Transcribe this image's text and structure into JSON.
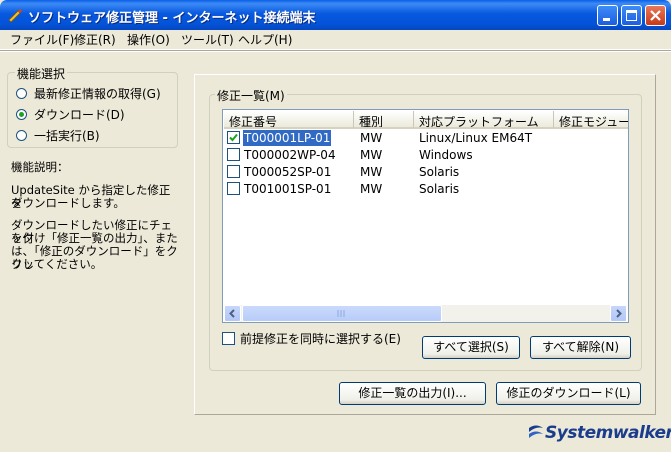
{
  "window": {
    "title": "ソフトウェア修正管理 - インターネット接続端末"
  },
  "menu": [
    "ファイル(F)",
    "修正(R)",
    "操作(O)",
    "ツール(T)",
    "ヘルプ(H)"
  ],
  "function_select": {
    "legend": "機能選択",
    "options": [
      {
        "label": "最新修正情報の取得(G)",
        "selected": false
      },
      {
        "label": "ダウンロード(D)",
        "selected": true
      },
      {
        "label": "一括実行(B)",
        "selected": false
      }
    ]
  },
  "description": {
    "heading": "機能説明：",
    "line1": "UpdateSite から指定した修正を",
    "line2": "ダウンロードします。",
    "line3": "ダウンロードしたい修正にチェック",
    "line4": "を付け「修正一覧の出力」、また",
    "line5": "は、「修正のダウンロード」をクリッ",
    "line6": "クしてください。"
  },
  "fix_list": {
    "legend": "修正一覧(M)",
    "columns": [
      "修正番号",
      "種別",
      "対応プラットフォーム",
      "修正モジュー"
    ],
    "rows": [
      {
        "id": "T000001LP-01",
        "type": "MW",
        "platform": "Linux/Linux EM64T",
        "checked": true,
        "selected": true
      },
      {
        "id": "T000002WP-04",
        "type": "MW",
        "platform": "Windows",
        "checked": false,
        "selected": false
      },
      {
        "id": "T000052SP-01",
        "type": "MW",
        "platform": "Solaris",
        "checked": false,
        "selected": false
      },
      {
        "id": "T001001SP-01",
        "type": "MW",
        "platform": "Solaris",
        "checked": false,
        "selected": false
      }
    ],
    "prereq_label": "前提修正を同時に選択する(E)",
    "select_all": "すべて選択(S)",
    "deselect_all": "すべて解除(N)"
  },
  "actions": {
    "export_list": "修正一覧の出力(I)...",
    "download": "修正のダウンロード(L)"
  },
  "brand": "Systemwalker",
  "colors": {
    "titlebar": "#0453D8",
    "face": "#ECE9D8",
    "selection": "#316AC5",
    "logo": "#1A3C8C"
  }
}
